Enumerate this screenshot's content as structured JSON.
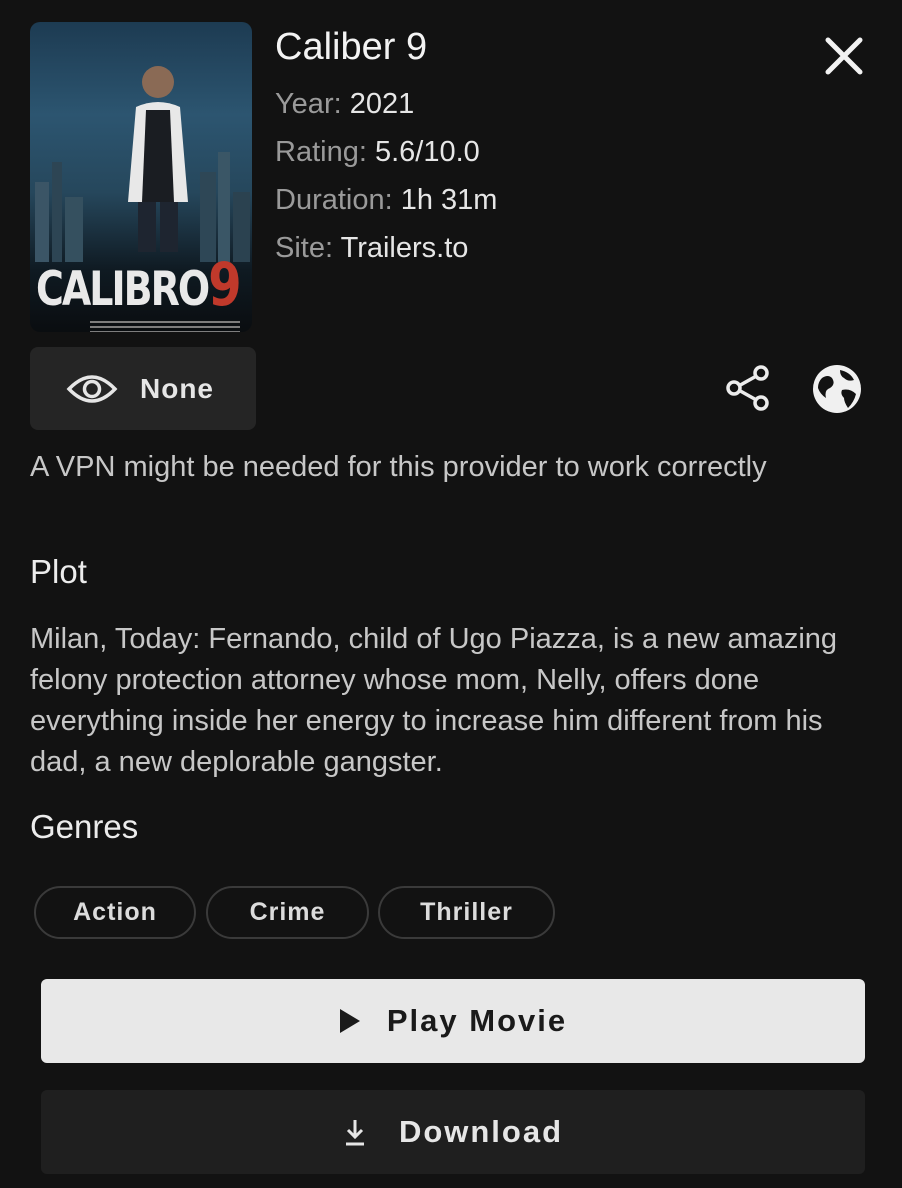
{
  "movie": {
    "title": "Caliber 9",
    "poster_title": "CALIBRO",
    "poster_number": "9",
    "year_label": "Year: ",
    "year": "2021",
    "rating_label": "Rating: ",
    "rating": "5.6/10.0",
    "duration_label": "Duration: ",
    "duration": "1h 31m",
    "site_label": "Site: ",
    "site": "Trailers.to"
  },
  "watch_status": {
    "label": "None",
    "icon": "eye-icon"
  },
  "actions": {
    "share_icon": "share-icon",
    "web_icon": "globe-icon",
    "close_icon": "close-icon"
  },
  "vpn_note": "A VPN might be needed for this provider to work correctly",
  "plot": {
    "heading": "Plot",
    "text": "Milan, Today: Fernando, child of Ugo Piazza, is a new amazing felony protection attorney whose mom, Nelly, offers done everything inside her energy to increase him different from his dad, a new deplorable gangster."
  },
  "genres": {
    "heading": "Genres",
    "items": [
      "Action",
      "Crime",
      "Thriller"
    ]
  },
  "buttons": {
    "play": "Play Movie",
    "play_icon": "play-icon",
    "download": "Download",
    "download_icon": "download-icon"
  },
  "colors": {
    "background": "#121212",
    "surface": "#252525",
    "primary_button": "#e8e8e8",
    "accent_red": "#c0392b"
  }
}
